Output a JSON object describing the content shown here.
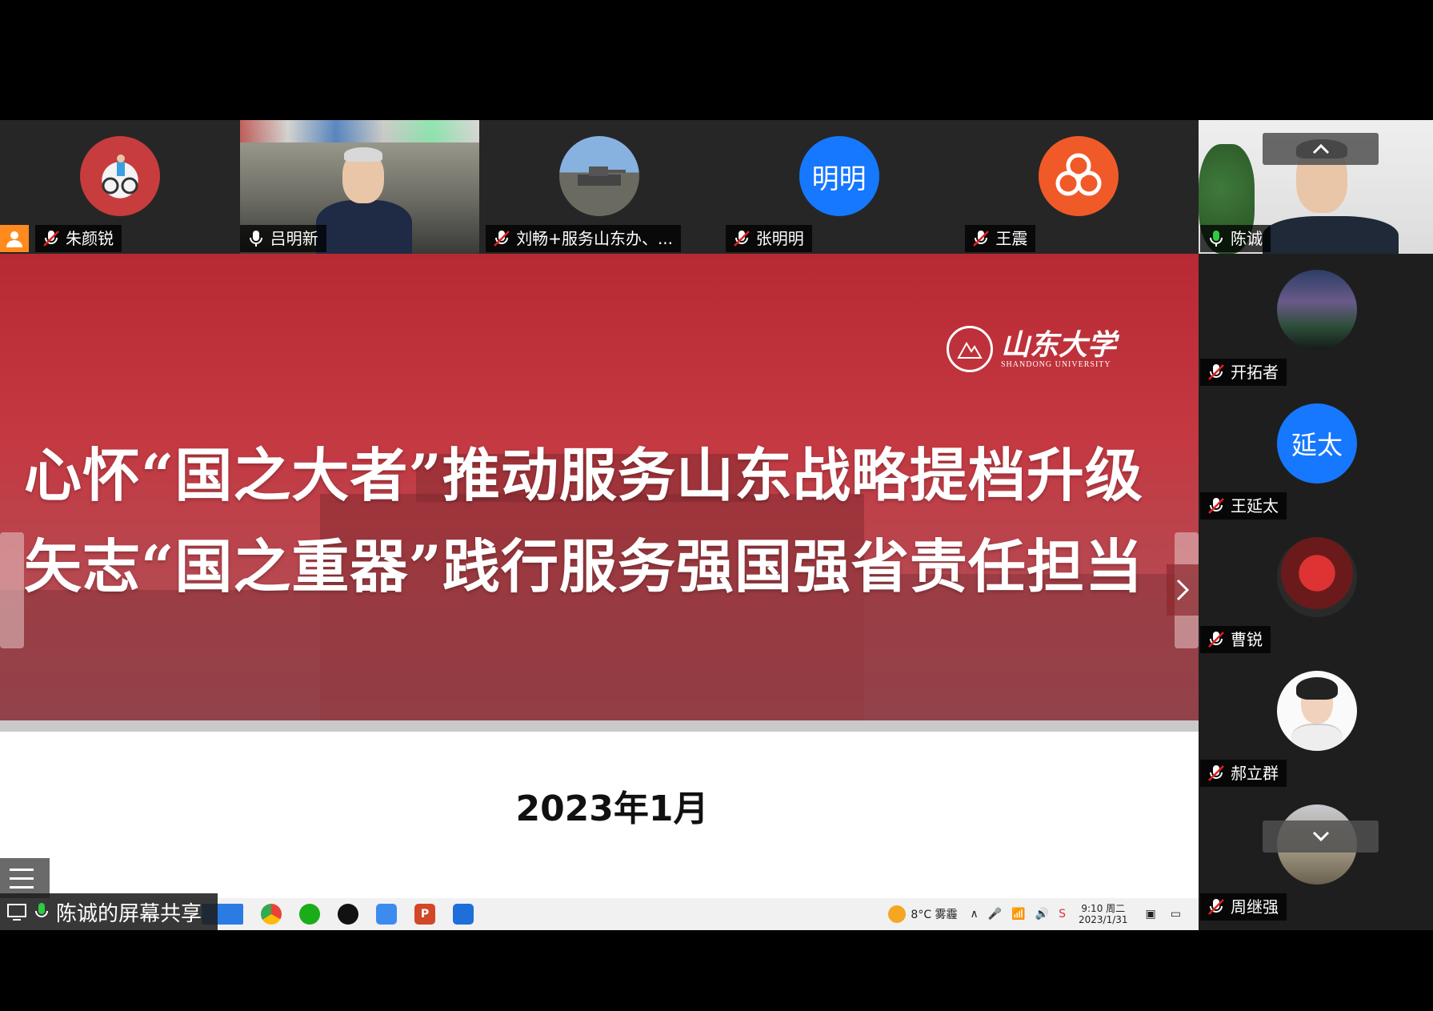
{
  "participants_top": [
    {
      "name": "朱颜锐",
      "mic": "muted",
      "kind": "photo-avatar"
    },
    {
      "name": "吕明新",
      "mic": "on",
      "kind": "video"
    },
    {
      "name": "刘畅+服务山东办、...",
      "mic": "muted",
      "kind": "photo-avatar"
    },
    {
      "name": "张明明",
      "mic": "muted",
      "kind": "text-avatar",
      "avatar_text": "明明",
      "avatar_color": "#1677ff"
    },
    {
      "name": "王震",
      "mic": "muted",
      "kind": "logo-avatar"
    }
  ],
  "participants_side": [
    {
      "name": "陈诚",
      "mic": "active",
      "kind": "video"
    },
    {
      "name": "开拓者",
      "mic": "muted",
      "kind": "photo-avatar"
    },
    {
      "name": "王延太",
      "mic": "muted",
      "kind": "text-avatar",
      "avatar_text": "延太",
      "avatar_color": "#1677ff"
    },
    {
      "name": "曹锐",
      "mic": "muted",
      "kind": "photo-avatar"
    },
    {
      "name": "郝立群",
      "mic": "muted",
      "kind": "photo-avatar"
    },
    {
      "name": "周继强",
      "mic": "muted",
      "kind": "photo-avatar"
    }
  ],
  "slide": {
    "title_line1": "心怀“国之大者”推动服务山东战略提档升级",
    "title_line2": "矢志“国之重器”践行服务强国强省责任担当",
    "logo_cn": "山东大学",
    "logo_en": "SHANDONG UNIVERSITY",
    "date": "2023年1月"
  },
  "share_banner": "陈诚的屏幕共享",
  "taskbar": {
    "weather": "8°C 雾霾",
    "time": "9:10 周二",
    "date": "2023/1/31"
  },
  "colors": {
    "slide_red": "#b81e28",
    "avatar_blue": "#1677ff",
    "mic_active": "#2ecc40"
  }
}
